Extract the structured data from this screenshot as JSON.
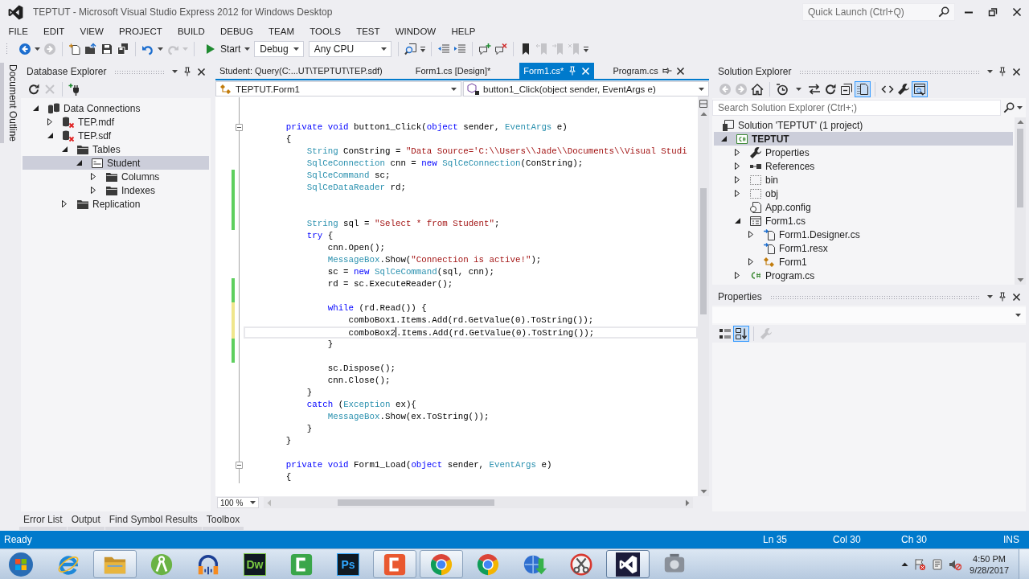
{
  "window": {
    "title": "TEPTUT - Microsoft Visual Studio Express 2012 for Windows Desktop",
    "quick_launch": {
      "placeholder": "Quick Launch (Ctrl+Q)"
    }
  },
  "menu": [
    "FILE",
    "EDIT",
    "VIEW",
    "PROJECT",
    "BUILD",
    "DEBUG",
    "TEAM",
    "TOOLS",
    "TEST",
    "WINDOW",
    "HELP"
  ],
  "toolbar": [
    [
      {
        "kind": "back",
        "disabled": false
      },
      {
        "kind": "caret",
        "disabled": false
      },
      {
        "kind": "forward",
        "disabled": true
      }
    ],
    [
      {
        "kind": "new-project",
        "disabled": false
      },
      {
        "kind": "open",
        "disabled": false
      },
      {
        "kind": "save",
        "disabled": false
      },
      {
        "kind": "save-all",
        "disabled": false
      }
    ],
    [
      {
        "kind": "undo",
        "disabled": false
      },
      {
        "kind": "caret",
        "disabled": false
      },
      {
        "kind": "redo",
        "disabled": true
      },
      {
        "kind": "caret",
        "disabled": true
      }
    ],
    [
      {
        "kind": "start",
        "label": "Start",
        "disabled": false
      },
      {
        "kind": "caret",
        "disabled": false
      },
      {
        "kind": "combo",
        "value": "Debug",
        "disabled": false
      },
      {
        "kind": "combo",
        "value": "Any CPU",
        "disabled": false
      }
    ],
    [
      {
        "kind": "find",
        "disabled": false
      },
      {
        "kind": "mini-caret",
        "disabled": false
      }
    ],
    [
      {
        "kind": "outdent",
        "disabled": false
      },
      {
        "kind": "indent",
        "disabled": false
      }
    ],
    [
      {
        "kind": "comment",
        "disabled": false
      },
      {
        "kind": "uncomment",
        "disabled": false
      }
    ],
    [
      {
        "kind": "bookmark",
        "disabled": false
      },
      {
        "kind": "bookmark-prev",
        "disabled": true
      },
      {
        "kind": "bookmark-next",
        "disabled": true
      },
      {
        "kind": "bookmark-clear",
        "disabled": true
      },
      {
        "kind": "mini-caret",
        "disabled": false
      }
    ]
  ],
  "side_tabs": [
    "Document Outline"
  ],
  "database_explorer": {
    "title": "Database Explorer",
    "toolbar": [
      [
        {
          "kind": "refresh",
          "disabled": false
        },
        {
          "kind": "stop",
          "disabled": true
        }
      ],
      [
        {
          "kind": "connect",
          "disabled": false
        }
      ]
    ],
    "tree": [
      {
        "label": "Data Connections",
        "kind": "connections",
        "expanded": true,
        "selected": false,
        "children": [
          {
            "label": "TEP.mdf",
            "kind": "database-error",
            "expanded": false,
            "selected": false
          },
          {
            "label": "TEP.sdf",
            "kind": "database-error",
            "expanded": true,
            "selected": false,
            "children": [
              {
                "label": "Tables",
                "kind": "folder",
                "expanded": true,
                "selected": false,
                "children": [
                  {
                    "label": "Student",
                    "kind": "table",
                    "expanded": true,
                    "selected": true,
                    "children": [
                      {
                        "label": "Columns",
                        "kind": "folder",
                        "expanded": false,
                        "selected": false
                      },
                      {
                        "label": "Indexes",
                        "kind": "folder",
                        "expanded": false,
                        "selected": false
                      }
                    ]
                  }
                ]
              },
              {
                "label": "Replication",
                "kind": "folder",
                "expanded": false,
                "selected": false
              }
            ]
          }
        ]
      }
    ]
  },
  "editor": {
    "tabs": [
      {
        "label": "Student: Query(C:...UT\\TEPTUT\\TEP.sdf)",
        "selected": false,
        "pinned": false
      },
      {
        "label": "Form1.cs [Design]*",
        "selected": false,
        "pinned": false
      },
      {
        "label": "Form1.cs*",
        "selected": true,
        "pinned": false
      },
      {
        "label": "Program.cs",
        "selected": false,
        "pinned": true
      }
    ],
    "type_selector": "TEPTUT.Form1",
    "member_selector": "button1_Click(object sender, EventArgs e)",
    "lines": [
      {
        "kind": "blank"
      },
      {
        "kind": "blank"
      },
      {
        "kind": "code",
        "fold": true,
        "current": false,
        "tokens": [
          {
            "kind": "keyword",
            "text": "        private"
          },
          {
            "kind": "keyword",
            "text": " void"
          },
          {
            "kind": "plain",
            "text": " button1_Click("
          },
          {
            "kind": "keyword",
            "text": "object"
          },
          {
            "kind": "plain",
            "text": " sender, "
          },
          {
            "kind": "type",
            "text": "EventArgs"
          },
          {
            "kind": "plain",
            "text": " e)"
          }
        ]
      },
      {
        "kind": "code",
        "fold": false,
        "current": false,
        "tokens": [
          {
            "kind": "plain",
            "text": "        {"
          }
        ]
      },
      {
        "kind": "code",
        "fold": false,
        "current": false,
        "tokens": [
          {
            "kind": "type",
            "text": "            String"
          },
          {
            "kind": "plain",
            "text": " ConString = "
          },
          {
            "kind": "string",
            "text": "\"Data Source='C:\\\\Users\\\\Jade\\\\Documents\\\\Visual Studi"
          }
        ]
      },
      {
        "kind": "code",
        "fold": false,
        "current": false,
        "tokens": [
          {
            "kind": "type",
            "text": "            SqlCeConnection"
          },
          {
            "kind": "plain",
            "text": " cnn = "
          },
          {
            "kind": "keyword",
            "text": "new"
          },
          {
            "kind": "type",
            "text": " SqlCeConnection"
          },
          {
            "kind": "plain",
            "text": "(ConString);"
          }
        ]
      },
      {
        "kind": "code",
        "color": "#5fcf5f",
        "fold": false,
        "current": false,
        "tokens": [
          {
            "kind": "type",
            "text": "            SqlCeCommand"
          },
          {
            "kind": "plain",
            "text": " sc;"
          }
        ]
      },
      {
        "kind": "code",
        "color": "#5fcf5f",
        "fold": false,
        "current": false,
        "tokens": [
          {
            "kind": "type",
            "text": "            SqlCeDataReader"
          },
          {
            "kind": "plain",
            "text": " rd;"
          }
        ]
      },
      {
        "kind": "blank",
        "color": "#5fcf5f"
      },
      {
        "kind": "blank",
        "color": "#5fcf5f"
      },
      {
        "kind": "code",
        "color": "#5fcf5f",
        "fold": false,
        "current": false,
        "tokens": [
          {
            "kind": "type",
            "text": "            String"
          },
          {
            "kind": "plain",
            "text": " sql = "
          },
          {
            "kind": "string",
            "text": "\"Select * from Student\""
          },
          {
            "kind": "plain",
            "text": ";"
          }
        ]
      },
      {
        "kind": "code",
        "fold": false,
        "current": false,
        "tokens": [
          {
            "kind": "keyword",
            "text": "            try"
          },
          {
            "kind": "plain",
            "text": " {"
          }
        ]
      },
      {
        "kind": "code",
        "fold": false,
        "current": false,
        "tokens": [
          {
            "kind": "plain",
            "text": "                cnn.Open();"
          }
        ]
      },
      {
        "kind": "code",
        "fold": false,
        "current": false,
        "tokens": [
          {
            "kind": "type",
            "text": "                MessageBox"
          },
          {
            "kind": "plain",
            "text": ".Show("
          },
          {
            "kind": "string",
            "text": "\"Connection is active!\""
          },
          {
            "kind": "plain",
            "text": ");"
          }
        ]
      },
      {
        "kind": "code",
        "fold": false,
        "current": false,
        "tokens": [
          {
            "kind": "plain",
            "text": "                sc = "
          },
          {
            "kind": "keyword",
            "text": "new"
          },
          {
            "kind": "type",
            "text": " SqlCeCommand"
          },
          {
            "kind": "plain",
            "text": "(sql, cnn);"
          }
        ]
      },
      {
        "kind": "code",
        "color": "#5fcf5f",
        "fold": false,
        "current": false,
        "tokens": [
          {
            "kind": "plain",
            "text": "                rd = sc.ExecuteReader();"
          }
        ]
      },
      {
        "kind": "blank",
        "color": "#5fcf5f"
      },
      {
        "kind": "code",
        "color": "#f0e68c",
        "fold": false,
        "current": false,
        "tokens": [
          {
            "kind": "keyword",
            "text": "                while"
          },
          {
            "kind": "plain",
            "text": " (rd.Read()) {"
          }
        ]
      },
      {
        "kind": "code",
        "color": "#f0e68c",
        "fold": false,
        "current": false,
        "tokens": [
          {
            "kind": "plain",
            "text": "                    comboBox1.Items.Add(rd.GetValue(0).ToString());"
          }
        ]
      },
      {
        "kind": "code",
        "color": "#f0e68c",
        "fold": false,
        "current": true,
        "tokens": [
          {
            "kind": "plain",
            "text": "                    comboBox2"
          },
          {
            "kind": "caret"
          },
          {
            "kind": "plain",
            "text": ".Items.Add(rd.GetValue(0).ToString());"
          }
        ]
      },
      {
        "kind": "code",
        "color": "#5fcf5f",
        "fold": false,
        "current": false,
        "tokens": [
          {
            "kind": "plain",
            "text": "                }"
          }
        ]
      },
      {
        "kind": "blank",
        "color": "#5fcf5f"
      },
      {
        "kind": "code",
        "fold": false,
        "current": false,
        "tokens": [
          {
            "kind": "plain",
            "text": "                sc.Dispose();"
          }
        ]
      },
      {
        "kind": "code",
        "fold": false,
        "current": false,
        "tokens": [
          {
            "kind": "plain",
            "text": "                cnn.Close();"
          }
        ]
      },
      {
        "kind": "code",
        "fold": false,
        "current": false,
        "tokens": [
          {
            "kind": "plain",
            "text": "            }"
          }
        ]
      },
      {
        "kind": "code",
        "fold": false,
        "current": false,
        "tokens": [
          {
            "kind": "keyword",
            "text": "            catch"
          },
          {
            "kind": "plain",
            "text": " ("
          },
          {
            "kind": "type",
            "text": "Exception"
          },
          {
            "kind": "plain",
            "text": " ex){"
          }
        ]
      },
      {
        "kind": "code",
        "fold": false,
        "current": false,
        "tokens": [
          {
            "kind": "type",
            "text": "                MessageBox"
          },
          {
            "kind": "plain",
            "text": ".Show(ex.ToString());"
          }
        ]
      },
      {
        "kind": "code",
        "fold": false,
        "current": false,
        "tokens": [
          {
            "kind": "plain",
            "text": "            }"
          }
        ]
      },
      {
        "kind": "code",
        "fold": false,
        "current": false,
        "tokens": [
          {
            "kind": "plain",
            "text": "        }"
          }
        ]
      },
      {
        "kind": "blank"
      },
      {
        "kind": "code",
        "fold": true,
        "current": false,
        "tokens": [
          {
            "kind": "keyword",
            "text": "        private"
          },
          {
            "kind": "keyword",
            "text": " void"
          },
          {
            "kind": "plain",
            "text": " Form1_Load("
          },
          {
            "kind": "keyword",
            "text": "object"
          },
          {
            "kind": "plain",
            "text": " sender, "
          },
          {
            "kind": "type",
            "text": "EventArgs"
          },
          {
            "kind": "plain",
            "text": " e)"
          }
        ]
      },
      {
        "kind": "code",
        "fold": false,
        "current": false,
        "tokens": [
          {
            "kind": "plain",
            "text": "        {"
          }
        ]
      }
    ],
    "zoom": "100 %"
  },
  "solution_explorer": {
    "title": "Solution Explorer",
    "toolbar": [
      [
        {
          "kind": "back",
          "disabled": true,
          "selected": false
        },
        {
          "kind": "forward",
          "disabled": true,
          "selected": false
        },
        {
          "kind": "home",
          "disabled": false,
          "selected": false
        }
      ],
      [
        {
          "kind": "pending",
          "disabled": false,
          "selected": false
        },
        {
          "kind": "caret",
          "disabled": false,
          "selected": false
        },
        {
          "kind": "sync",
          "disabled": false,
          "selected": false
        },
        {
          "kind": "refresh",
          "disabled": false,
          "selected": false
        },
        {
          "kind": "collapse-all",
          "disabled": false,
          "selected": false
        },
        {
          "kind": "show-all",
          "disabled": false,
          "selected": true
        }
      ],
      [
        {
          "kind": "view-code",
          "disabled": false,
          "selected": false
        },
        {
          "kind": "wrench",
          "disabled": false,
          "selected": false
        },
        {
          "kind": "preview",
          "disabled": false,
          "selected": true
        }
      ]
    ],
    "search": {
      "placeholder": "Search Solution Explorer (Ctrl+;)"
    },
    "tree": [
      {
        "label": "Solution 'TEPTUT' (1 project)",
        "kind": "solution",
        "selected": false,
        "children": [
          {
            "label": "TEPTUT",
            "kind": "project",
            "expanded": true,
            "selected": true,
            "children": [
              {
                "label": "Properties",
                "kind": "wrench",
                "expanded": false,
                "selected": false
              },
              {
                "label": "References",
                "kind": "references",
                "expanded": false,
                "selected": false
              },
              {
                "label": "bin",
                "kind": "hidden-folder",
                "expanded": false,
                "selected": false
              },
              {
                "label": "obj",
                "kind": "hidden-folder",
                "expanded": false,
                "selected": false
              },
              {
                "label": "App.config",
                "kind": "config",
                "selected": false
              },
              {
                "label": "Form1.cs",
                "kind": "form",
                "expanded": true,
                "selected": false,
                "children": [
                  {
                    "label": "Form1.Designer.cs",
                    "kind": "dependent-file",
                    "expanded": false,
                    "selected": false
                  },
                  {
                    "label": "Form1.resx",
                    "kind": "dependent-file",
                    "selected": false
                  },
                  {
                    "label": "Form1",
                    "kind": "class",
                    "expanded": false,
                    "selected": false
                  }
                ]
              },
              {
                "label": "Program.cs",
                "kind": "csharp-file",
                "expanded": false,
                "selected": false
              }
            ]
          }
        ]
      }
    ]
  },
  "properties": {
    "title": "Properties",
    "toolbar": [
      [
        {
          "kind": "categorized",
          "disabled": false,
          "selected": false
        },
        {
          "kind": "alphabetical",
          "disabled": false,
          "selected": true
        }
      ],
      [
        {
          "kind": "wrench",
          "disabled": true,
          "selected": false
        }
      ]
    ]
  },
  "tool_tabs": [
    "Error List",
    "Output",
    "Find Symbol Results",
    "Toolbox"
  ],
  "status_bar": {
    "message": "Ready",
    "line": "Ln 35",
    "column": "Col 30",
    "character": "Ch 30",
    "mode": "INS"
  },
  "taskbar": {
    "apps": [
      {
        "kind": "ie",
        "running": false,
        "selected": false
      },
      {
        "kind": "explorer",
        "running": true,
        "selected": false
      },
      {
        "kind": "android-studio",
        "running": false,
        "selected": false
      },
      {
        "kind": "audacity",
        "running": false,
        "selected": false
      },
      {
        "kind": "letter-tile",
        "label": "Dw",
        "color": "#7ac943",
        "running": false,
        "selected": false
      },
      {
        "kind": "bracket-tile",
        "color": "#3aa64a",
        "running": false,
        "selected": false
      },
      {
        "kind": "letter-tile",
        "label": "Ps",
        "color": "#31a8ff",
        "running": false,
        "selected": false
      },
      {
        "kind": "bracket-tile",
        "color": "#e9582f",
        "running": true,
        "selected": false
      },
      {
        "kind": "chrome",
        "running": true,
        "selected": false
      },
      {
        "kind": "chrome",
        "running": false,
        "selected": false
      },
      {
        "kind": "idm",
        "running": false,
        "selected": false
      },
      {
        "kind": "snipping",
        "running": false,
        "selected": false
      },
      {
        "kind": "vs",
        "running": true,
        "selected": true
      },
      {
        "kind": "device-app",
        "running": false,
        "selected": false
      }
    ],
    "clock": {
      "time": "4:50 PM",
      "date": "9/28/2017"
    }
  }
}
